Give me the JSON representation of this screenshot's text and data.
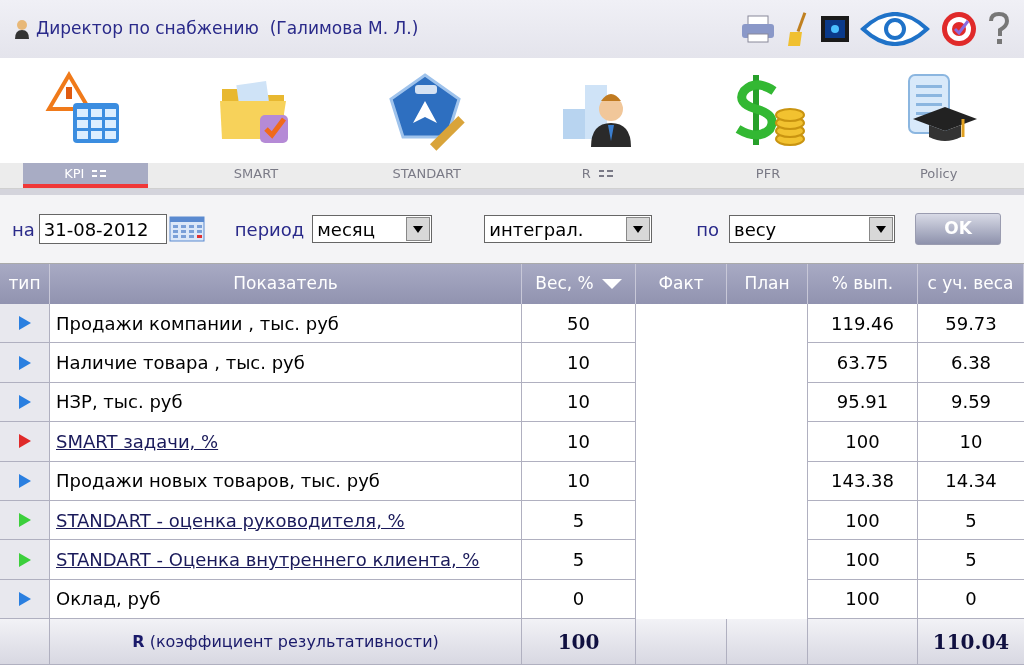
{
  "header": {
    "title": "Директор по снабжению  (Галимова М. Л.)"
  },
  "modules": [
    {
      "label": "KPI",
      "menu": true,
      "selected": true
    },
    {
      "label": "SMART",
      "menu": false,
      "selected": false
    },
    {
      "label": "STANDART",
      "menu": false,
      "selected": false
    },
    {
      "label": "R",
      "menu": true,
      "selected": false
    },
    {
      "label": "PFR",
      "menu": false,
      "selected": false
    },
    {
      "label": "Policy",
      "menu": false,
      "selected": false
    }
  ],
  "filters": {
    "date_label": "на",
    "date": "31-08-2012",
    "period_label": "период",
    "period": "месяц",
    "mode": "интеграл.",
    "by_label": "по",
    "by": "весу",
    "ok": "OK"
  },
  "table": {
    "columns": [
      "тип",
      "Показатель",
      "Вес, %",
      "Факт",
      "План",
      "% вып.",
      "с уч. веса"
    ],
    "rows": [
      {
        "color": "#2a7fe0",
        "kind": "text",
        "name": "Продажи компании , тыс. руб",
        "weight": "50",
        "pct": "119.46",
        "weighted": "59.73"
      },
      {
        "color": "#2a7fe0",
        "kind": "text",
        "name": "Наличие товара , тыс. руб",
        "weight": "10",
        "pct": "63.75",
        "weighted": "6.38"
      },
      {
        "color": "#2a7fe0",
        "kind": "text",
        "name": "НЗР, тыс. руб",
        "weight": "10",
        "pct": "95.91",
        "weighted": "9.59"
      },
      {
        "color": "#e02a2a",
        "kind": "link",
        "name": "SMART задачи, %",
        "weight": "10",
        "pct": "100",
        "weighted": "10"
      },
      {
        "color": "#2a7fe0",
        "kind": "text",
        "name": "Продажи новых товаров, тыс. руб",
        "weight": "10",
        "pct": "143.38",
        "weighted": "14.34"
      },
      {
        "color": "#3ccf3c",
        "kind": "link",
        "name": "STANDART - оценка руководителя, %",
        "weight": "5",
        "pct": "100",
        "weighted": "5"
      },
      {
        "color": "#3ccf3c",
        "kind": "link",
        "name": "STANDART - Оценка внутреннего клиента, %",
        "weight": "5",
        "pct": "100",
        "weighted": "5"
      },
      {
        "color": "#2a7fe0",
        "kind": "text",
        "name": "Оклад, руб",
        "weight": "0",
        "pct": "100",
        "weighted": "0"
      }
    ],
    "total": {
      "label": "**R** (коэффициент результативности)",
      "weight": "100",
      "weighted": "110.04"
    }
  }
}
